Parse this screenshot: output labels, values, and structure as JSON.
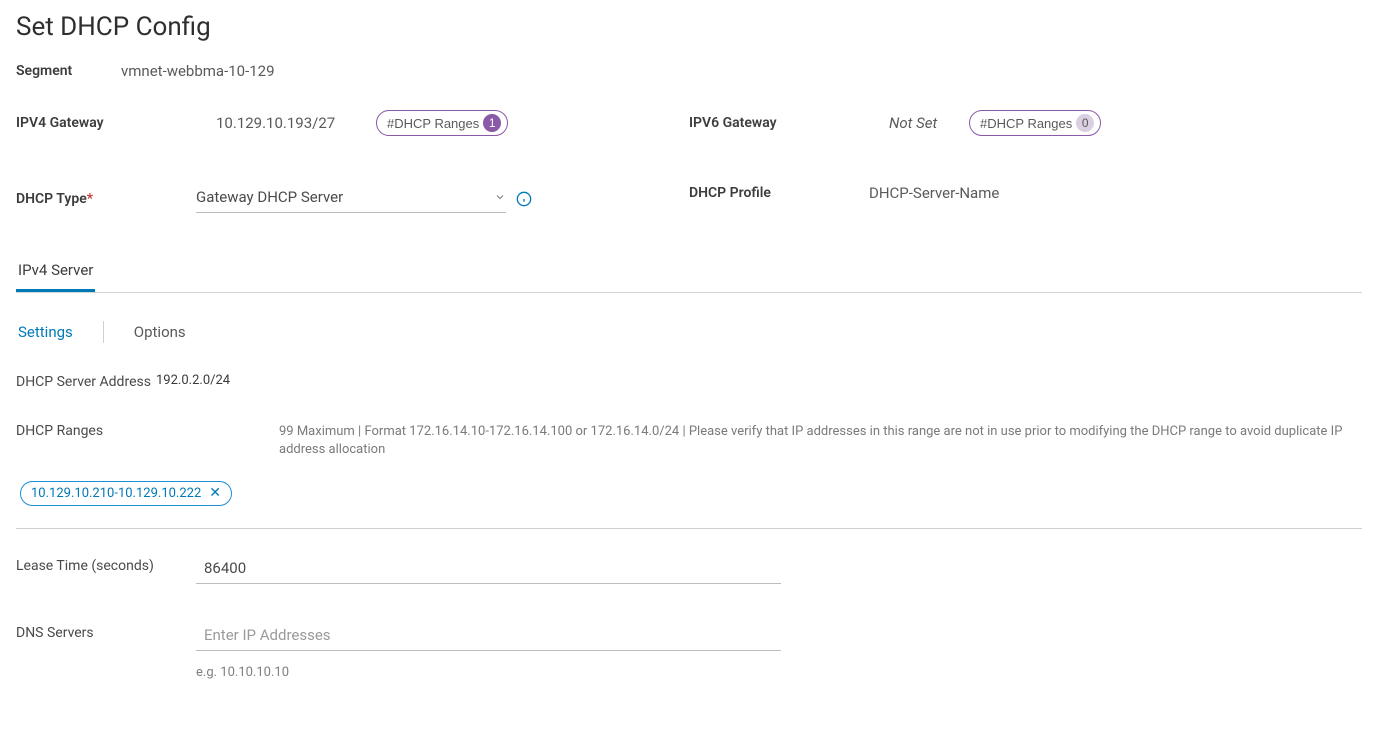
{
  "title": "Set DHCP Config",
  "segment": {
    "label": "Segment",
    "value": "vmnet-webbma-10-129"
  },
  "ipv4_gateway": {
    "label": "IPV4 Gateway",
    "value": "10.129.10.193/27",
    "badge_label": "#DHCP Ranges",
    "badge_count": "1"
  },
  "ipv6_gateway": {
    "label": "IPV6 Gateway",
    "value": "Not Set",
    "badge_label": "#DHCP Ranges",
    "badge_count": "0"
  },
  "dhcp_type": {
    "label": "DHCP Type",
    "value": "Gateway DHCP Server"
  },
  "dhcp_profile": {
    "label": "DHCP Profile",
    "value": "DHCP-Server-Name"
  },
  "primary_tabs": [
    {
      "label": "IPv4 Server"
    }
  ],
  "secondary_tabs": [
    {
      "label": "Settings"
    },
    {
      "label": "Options"
    }
  ],
  "dhcp_server_address": {
    "label": "DHCP Server Address",
    "value": "192.0.2.0/24"
  },
  "dhcp_ranges": {
    "label": "DHCP Ranges",
    "help": "99 Maximum | Format 172.16.14.10-172.16.14.100 or 172.16.14.0/24 | Please verify that IP addresses in this range are not in use prior to modifying the DHCP range to avoid duplicate IP address allocation",
    "chip": "10.129.10.210-10.129.10.222"
  },
  "lease_time": {
    "label": "Lease Time (seconds)",
    "value": "86400"
  },
  "dns_servers": {
    "label": "DNS Servers",
    "placeholder": "Enter IP Addresses",
    "hint": "e.g. 10.10.10.10"
  }
}
